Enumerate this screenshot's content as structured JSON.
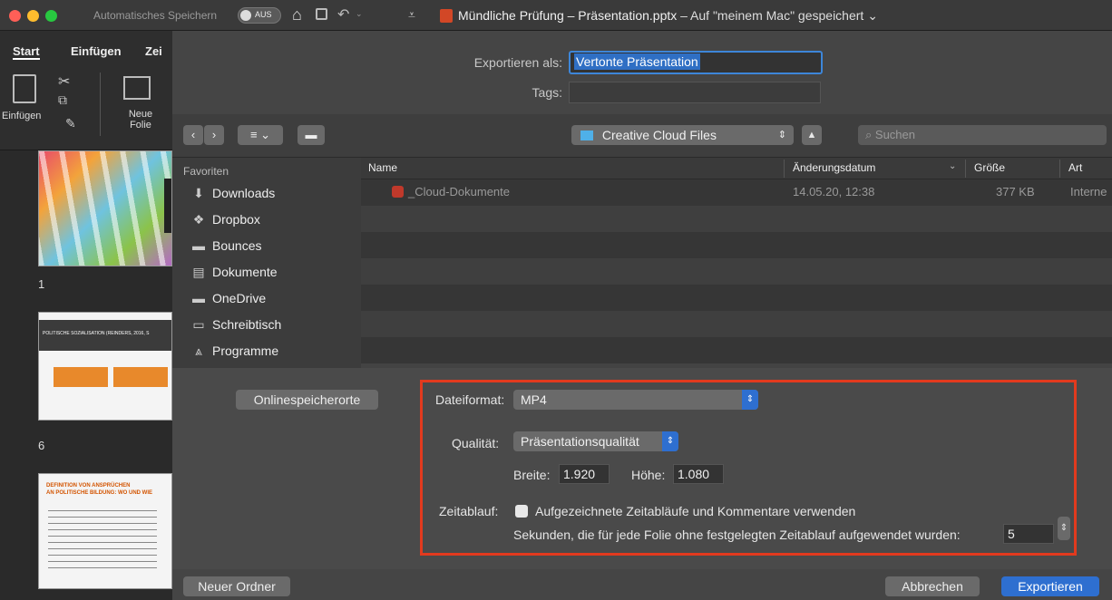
{
  "titlebar": {
    "autosave_label": "Automatisches Speichern",
    "autosave_toggle": "AUS",
    "file_name": "Mündliche Prüfung – Präsentation.pptx",
    "save_status": "– Auf \"meinem Mac\" gespeichert"
  },
  "ribbon": {
    "tabs": [
      "Start",
      "Einfügen",
      "Zei"
    ],
    "paste_label": "Einfügen",
    "new_slide_label": "Neue Folie"
  },
  "slides": {
    "numbers": [
      "1",
      "6"
    ],
    "slide6_title": "POLITISCHE SOZIALISATION (REINDERS, 2016, S",
    "slide_def_title_1": "DEFINITION VON ANSPRÜCHEN",
    "slide_def_title_2": "AN POLITISCHE BILDUNG: WO UND WIE"
  },
  "dialog": {
    "export_as_label": "Exportieren als:",
    "export_as_value": "Vertonte Präsentation",
    "tags_label": "Tags:",
    "location": "Creative Cloud Files",
    "search_placeholder": "Suchen",
    "sidebar_heading": "Favoriten",
    "sidebar_items": [
      "Downloads",
      "Dropbox",
      "Bounces",
      "Dokumente",
      "OneDrive",
      "Schreibtisch",
      "Programme"
    ],
    "columns": {
      "name": "Name",
      "date": "Änderungsdatum",
      "size": "Größe",
      "kind": "Art"
    },
    "files": [
      {
        "name": "_Cloud-Dokumente",
        "date": "14.05.20, 12:38",
        "size": "377 KB",
        "kind": "Interne"
      }
    ],
    "online_button": "Onlinespeicherorte",
    "format_label": "Dateiformat:",
    "format_value": "MP4",
    "quality_label": "Qualität:",
    "quality_value": "Präsentationsqualität",
    "width_label": "Breite:",
    "width_value": "1.920",
    "height_label": "Höhe:",
    "height_value": "1.080",
    "timing_label": "Zeitablauf:",
    "timing_checkbox": "Aufgezeichnete Zeitabläufe und Kommentare verwenden",
    "seconds_label": "Sekunden, die für jede Folie ohne festgelegten Zeitablauf aufgewendet wurden:",
    "seconds_value": "5",
    "new_folder": "Neuer Ordner",
    "cancel": "Abbrechen",
    "export": "Exportieren"
  },
  "colors": {
    "accent": "#2e6fd0",
    "highlight_box": "#e23a1e"
  }
}
